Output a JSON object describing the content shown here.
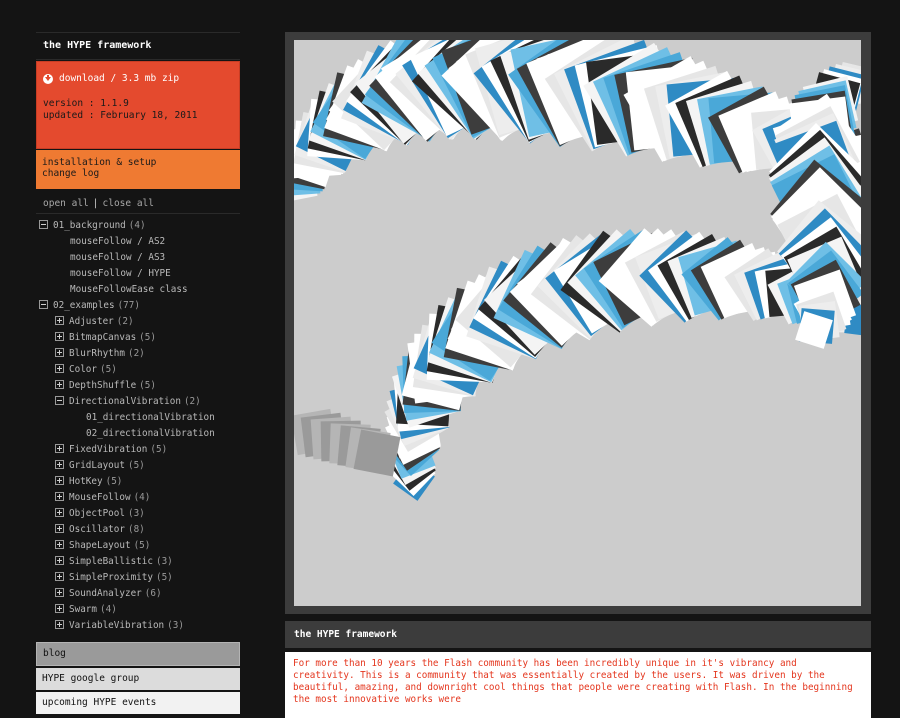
{
  "sidebar": {
    "title": "the HYPE framework",
    "download": {
      "label": "download / 3.3 mb zip",
      "version": "version : 1.1.9",
      "updated": "updated : February 18, 2011"
    },
    "setup_links": [
      "installation & setup",
      "change log"
    ],
    "open_all": "open all",
    "separator": "|",
    "close_all": "close all",
    "tree": [
      {
        "label": "01_background",
        "count": "(4)",
        "level": "lvl0",
        "toggle": "minus"
      },
      {
        "label": "mouseFollow / AS2",
        "count": "",
        "level": "lvl1leaf",
        "toggle": ""
      },
      {
        "label": "mouseFollow / AS3",
        "count": "",
        "level": "lvl1leaf",
        "toggle": ""
      },
      {
        "label": "mouseFollow / HYPE",
        "count": "",
        "level": "lvl1leaf",
        "toggle": ""
      },
      {
        "label": "MouseFollowEase class",
        "count": "",
        "level": "lvl1leaf",
        "toggle": ""
      },
      {
        "label": "02_examples",
        "count": "(77)",
        "level": "lvl0",
        "toggle": "minus"
      },
      {
        "label": "Adjuster",
        "count": "(2)",
        "level": "lvl1",
        "toggle": "plus"
      },
      {
        "label": "BitmapCanvas",
        "count": "(5)",
        "level": "lvl1",
        "toggle": "plus"
      },
      {
        "label": "BlurRhythm",
        "count": "(2)",
        "level": "lvl1",
        "toggle": "plus"
      },
      {
        "label": "Color",
        "count": "(5)",
        "level": "lvl1",
        "toggle": "plus"
      },
      {
        "label": "DepthShuffle",
        "count": "(5)",
        "level": "lvl1",
        "toggle": "plus"
      },
      {
        "label": "DirectionalVibration",
        "count": "(2)",
        "level": "lvl1",
        "toggle": "minus"
      },
      {
        "label": "01_directionalVibration",
        "count": "",
        "level": "lvl2leaf",
        "toggle": ""
      },
      {
        "label": "02_directionalVibration",
        "count": "",
        "level": "lvl2leaf",
        "toggle": ""
      },
      {
        "label": "FixedVibration",
        "count": "(5)",
        "level": "lvl1",
        "toggle": "plus"
      },
      {
        "label": "GridLayout",
        "count": "(5)",
        "level": "lvl1",
        "toggle": "plus"
      },
      {
        "label": "HotKey",
        "count": "(5)",
        "level": "lvl1",
        "toggle": "plus"
      },
      {
        "label": "MouseFollow",
        "count": "(4)",
        "level": "lvl1",
        "toggle": "plus"
      },
      {
        "label": "ObjectPool",
        "count": "(3)",
        "level": "lvl1",
        "toggle": "plus"
      },
      {
        "label": "Oscillator",
        "count": "(8)",
        "level": "lvl1",
        "toggle": "plus"
      },
      {
        "label": "ShapeLayout",
        "count": "(5)",
        "level": "lvl1",
        "toggle": "plus"
      },
      {
        "label": "SimpleBallistic",
        "count": "(3)",
        "level": "lvl1",
        "toggle": "plus"
      },
      {
        "label": "SimpleProximity",
        "count": "(5)",
        "level": "lvl1",
        "toggle": "plus"
      },
      {
        "label": "SoundAnalyzer",
        "count": "(6)",
        "level": "lvl1",
        "toggle": "plus"
      },
      {
        "label": "Swarm",
        "count": "(4)",
        "level": "lvl1",
        "toggle": "plus"
      },
      {
        "label": "VariableVibration",
        "count": "(3)",
        "level": "lvl1",
        "toggle": "plus"
      }
    ],
    "blog": "blog",
    "google_group": "HYPE google group",
    "events": "upcoming HYPE events"
  },
  "about": {
    "title": "the HYPE framework",
    "body": "For more than 10 years the Flash community has been incredibly unique in it's vibrancy and creativity. This is a community that was essentially created by the users. It was driven by the beautiful, amazing, and downright cool things that people were creating with Flash. In the beginning the most innovative works were"
  },
  "colors": {
    "download_bg": "#e44a2e",
    "setup_bg": "#ef7a32",
    "about_text": "#e4361e",
    "stage_bg": "#cccccc",
    "ribbon_blue": "#4aa8d8",
    "ribbon_dark": "#2a2a2a"
  }
}
